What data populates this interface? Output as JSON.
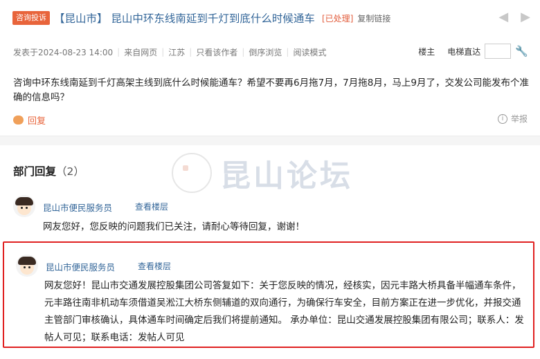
{
  "header": {
    "tag": "咨询投诉",
    "title": "【昆山市】 昆山中环东线南延到千灯到底什么时候通车",
    "status": "[已处理]",
    "copy_link": "复制链接",
    "prev_icon": "arrow-left-icon",
    "next_icon": "arrow-right-icon"
  },
  "meta": {
    "posted": "发表于2024-08-23 14:00",
    "source": "来自网页",
    "region": "江苏",
    "author_only": "只看该作者",
    "reverse": "倒序浏览",
    "read_mode": "阅读模式",
    "floor_owner": "楼主",
    "elevator": "电梯直达",
    "jump_value": ""
  },
  "post": {
    "content": "咨询中环东线南延到千灯高架主线到底什么时候能通车？希望不要再6月拖7月，7月拖8月，马上9月了，交发公司能发布个准确的信息吗？",
    "reply_label": "回复",
    "report_label": "举报"
  },
  "watermark": {
    "text": "昆山论坛"
  },
  "replies_section": {
    "title": "部门回复",
    "count": "（2）",
    "items": [
      {
        "author": "昆山市便民服务员",
        "floor_link": "查看楼层",
        "text": "网友您好，您反映的问题我们已关注，请耐心等待回复，谢谢！"
      },
      {
        "author": "昆山市便民服务员",
        "floor_link": "查看楼层",
        "text": "网友您好！昆山市交通发展控股集团公司答复如下：关于您反映的情况，经核实，因元丰路大桥具备半幅通车条件，元丰路往南非机动车须借道吴淞江大桥东侧辅道的双向通行，为确保行车安全，目前方案正在进一步优化，并报交通主管部门审核确认，具体通车时间确定后我们将提前通知。 承办单位：昆山交通发展控股集团有限公司；联系人：发帖人可见；联系电话：发帖人可见"
      }
    ]
  },
  "colors": {
    "tag_bg": "#e8643b",
    "link": "#336699",
    "status": "#e25c3b",
    "highlight_border": "#e02020"
  }
}
